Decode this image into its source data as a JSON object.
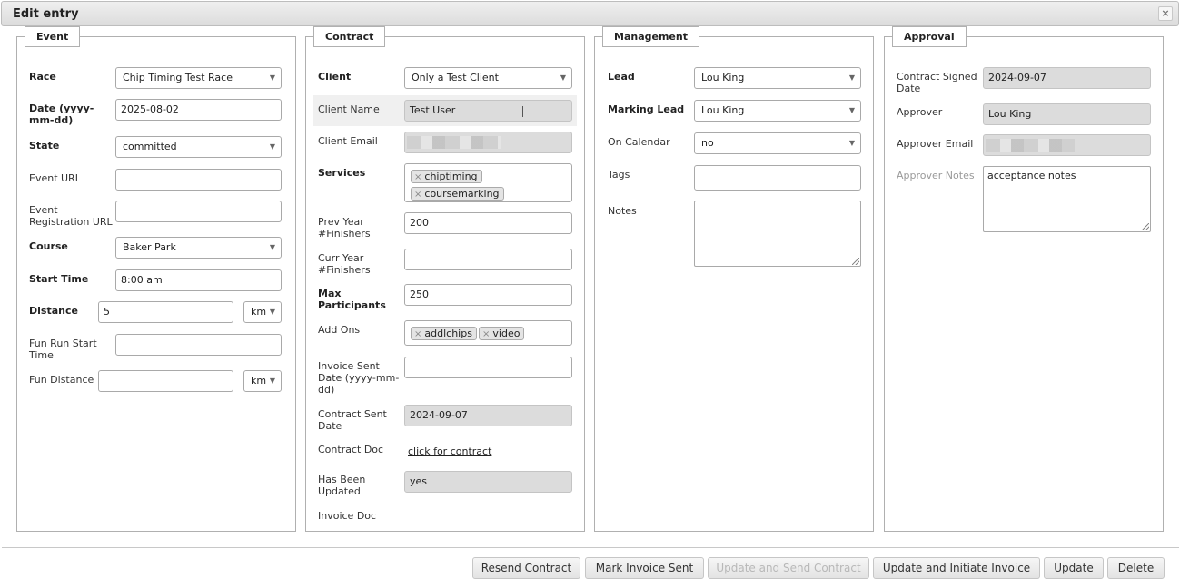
{
  "dialog": {
    "title": "Edit entry",
    "close_glyph": "×"
  },
  "event": {
    "legend": "Event",
    "race_label": "Race",
    "race_value": "Chip Timing Test Race",
    "date_label": "Date (yyyy-mm-dd)",
    "date_label_1": "Date (yyyy-",
    "date_label_2": "mm-dd)",
    "date_value": "2025-08-02",
    "state_label": "State",
    "state_value": "committed",
    "event_url_label": "Event URL",
    "event_url_value": "",
    "reg_url_label_1": "Event",
    "reg_url_label_2": "Registration URL",
    "reg_url_value": "",
    "course_label": "Course",
    "course_value": "Baker Park",
    "start_time_label": "Start Time",
    "start_time_value": "8:00 am",
    "distance_label": "Distance",
    "distance_value": "5",
    "distance_unit": "km",
    "fun_start_label_1": "Fun Run Start",
    "fun_start_label_2": "Time",
    "fun_start_value": "",
    "fun_distance_label": "Fun Distance",
    "fun_distance_value": "",
    "fun_distance_unit": "km"
  },
  "contract": {
    "legend": "Contract",
    "client_label": "Client",
    "client_value": "Only a Test Client",
    "client_name_label": "Client Name",
    "client_name_value": "Test User",
    "client_email_label": "Client Email",
    "services_label": "Services",
    "services": [
      "chiptiming",
      "coursemarking"
    ],
    "prev_label_1": "Prev Year",
    "prev_label_2": "#Finishers",
    "prev_value": "200",
    "curr_label_1": "Curr Year",
    "curr_label_2": "#Finishers",
    "curr_value": "",
    "max_label_1": "Max",
    "max_label_2": "Participants",
    "max_value": "250",
    "addons_label": "Add Ons",
    "addons": [
      "addlchips",
      "video"
    ],
    "invoice_sent_label_1": "Invoice Sent",
    "invoice_sent_label_2": "Date (yyyy-mm-",
    "invoice_sent_label_3": "dd)",
    "invoice_sent_value": "",
    "contract_sent_label_1": "Contract Sent",
    "contract_sent_label_2": "Date",
    "contract_sent_value": "2024-09-07",
    "contract_doc_label": "Contract Doc",
    "contract_doc_link": "click for contract",
    "updated_label_1": "Has Been",
    "updated_label_2": "Updated",
    "updated_value": "yes",
    "invoice_doc_label": "Invoice Doc"
  },
  "management": {
    "legend": "Management",
    "lead_label": "Lead",
    "lead_value": "Lou King",
    "marking_lead_label": "Marking Lead",
    "marking_lead_value": "Lou King",
    "on_calendar_label": "On Calendar",
    "on_calendar_value": "no",
    "tags_label": "Tags",
    "tags_value": "",
    "notes_label": "Notes",
    "notes_value": ""
  },
  "approval": {
    "legend": "Approval",
    "signed_label_1": "Contract Signed",
    "signed_label_2": "Date",
    "signed_value": "2024-09-07",
    "approver_label": "Approver",
    "approver_value": "Lou King",
    "approver_email_label": "Approver Email",
    "notes_label": "Approver Notes",
    "notes_value": "acceptance notes"
  },
  "buttons": {
    "resend": "Resend Contract",
    "mark_invoice": "Mark Invoice Sent",
    "update_send": "Update and Send Contract",
    "update_invoice": "Update and Initiate Invoice",
    "update": "Update",
    "delete": "Delete"
  },
  "icons": {
    "dropdown": "▼",
    "remove_chip": "×"
  }
}
